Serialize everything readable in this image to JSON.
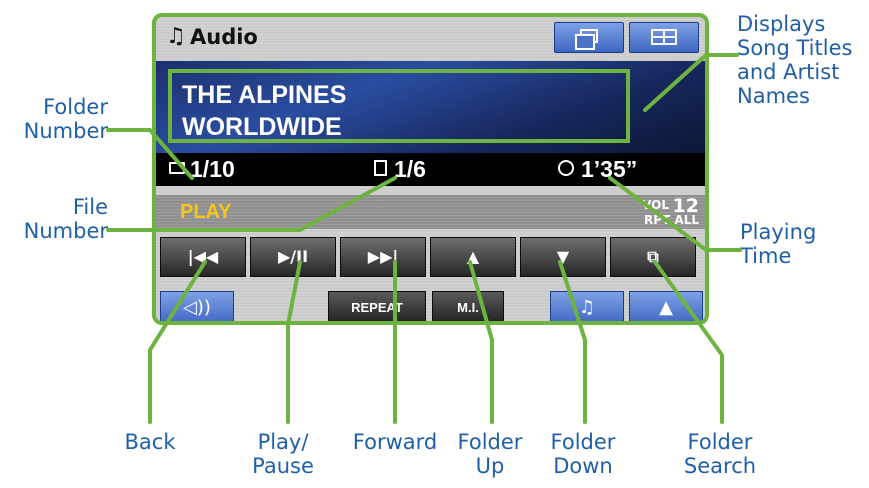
{
  "screen": {
    "title": "Audio",
    "song_title": "THE ALPINES",
    "song_artist": "WORLDWIDE",
    "folder_number": "1/10",
    "file_number": "1/6",
    "playing_time": "1’35”",
    "play_status": "PLAY",
    "volume_label": "VOL",
    "volume_value": "12",
    "repeat_status": "RPT ALL",
    "controls": {
      "back": "|◀◀",
      "play_pause": "▶/II",
      "forward": "▶▶|",
      "folder_up": "▲",
      "folder_down": "▼",
      "folder_search": "⧉"
    },
    "bottom": {
      "sound": "◁))",
      "repeat": "REPEAT",
      "mix": "M.I.",
      "music": "♫",
      "nav": "▲"
    }
  },
  "callouts": {
    "folder_number": "Folder\nNumber",
    "file_number": "File\nNumber",
    "displays_song": "Displays\nSong Titles\nand Artist\nNames",
    "playing_time": "Playing\nTime",
    "back": "Back",
    "play_pause": "Play/\nPause",
    "forward": "Forward",
    "folder_up": "Folder\nUp",
    "folder_down": "Folder\nDown",
    "folder_search": "Folder\nSearch"
  },
  "colors": {
    "callout_text": "#1f5fa8",
    "highlight": "#6cb33f",
    "play_text": "#f5c518"
  }
}
